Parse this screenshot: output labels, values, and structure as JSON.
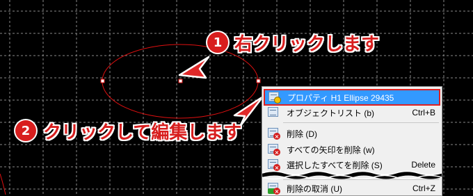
{
  "annotations": {
    "step1": {
      "number": "1",
      "text": "右クリックします"
    },
    "step2": {
      "number": "2",
      "text": "クリックして編集します"
    }
  },
  "context_menu": {
    "items": [
      {
        "label": "プロパティ H1 Ellipse 29435",
        "shortcut": "",
        "icon": "properties-icon",
        "selected": true
      },
      {
        "label": "オブジェクトリスト (b)",
        "shortcut": "Ctrl+B",
        "icon": "object-list-icon"
      },
      {
        "label": "削除 (D)",
        "shortcut": "",
        "icon": "delete-icon"
      },
      {
        "label": "すべての矢印を削除 (w)",
        "shortcut": "",
        "icon": "delete-arrows-icon"
      },
      {
        "label": "選択したすべてを削除 (S)",
        "shortcut": "Delete",
        "icon": "delete-selected-icon"
      },
      {
        "label": "削除の取消 (U)",
        "shortcut": "Ctrl+Z",
        "icon": "undo-delete-icon"
      }
    ]
  },
  "colors": {
    "background": "#000000",
    "grid": "#8a8a8a",
    "ellipse": "#e01010",
    "annotation": "#d81e1e",
    "selection": "#3399ff"
  }
}
